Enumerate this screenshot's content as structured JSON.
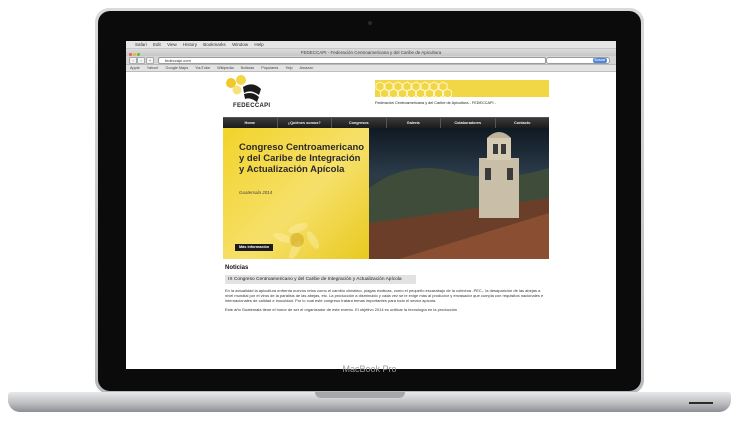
{
  "device": {
    "label": "MacBook Pro"
  },
  "os_menubar": {
    "items": [
      "Safari",
      "Edit",
      "View",
      "Bookmarks",
      "Window",
      "Help",
      "Window",
      "History"
    ],
    "right_text": "FEDECCAPI - Federación Centroamericana y del Caribe de Apicultura"
  },
  "browser": {
    "window_title": "FEDECCAPI - Federación Centroamericana y del Caribe de Apicultura",
    "url": "fedeccapi.com",
    "search_button": "Buscar",
    "bookmarks": [
      "Apple",
      "Yahoo!",
      "Google Maps",
      "YouTube",
      "Wikipedia",
      "Noticias",
      "Populares",
      "Yelp",
      "Amazon"
    ]
  },
  "site": {
    "logo_text": "FEDECCAPI",
    "header_tagline": "Federación Centroamericana y del Caribe de Apicultura - FEDECCAPI -",
    "nav": [
      "Home",
      "¿Quiénes somos?",
      "Congresos",
      "Galería",
      "Colaboradores",
      "Contacto"
    ],
    "hero": {
      "title": "Congreso Centroamericano y del Caribe de Integración y Actualización Apícola",
      "subtitle": "Guatemala 2014",
      "button": "Más información"
    },
    "news": {
      "title": "Noticias",
      "headline": "IX Congreso Centroamericano y del Caribe de Integración y Actualización Apícola",
      "paragraph1": "En la actualidad la apicultura enfrenta nuevos retos como el cambio climático, plagas exóticas, como el pequeño escarabajo de la colmena -PEC-, la desaparición de las abejas a nivel mundial por el virus de la parálisis de las abejas, etc. La producción a disminuido y cada vez se le exige más al productor y envasador que cumpla con requisitos nacionales e internacionales de calidad e inocuidad. Por lo cual este congreso tratara temas importantes para todo el sector apícola.",
      "paragraph2": "Este año Guatemala tiene el honor de ser el organizador de este evento. El objetivo 2014 es unificar la tecnología en la producción"
    },
    "colors": {
      "yellow": "#f1d645",
      "nav_bg": "#222222"
    }
  }
}
